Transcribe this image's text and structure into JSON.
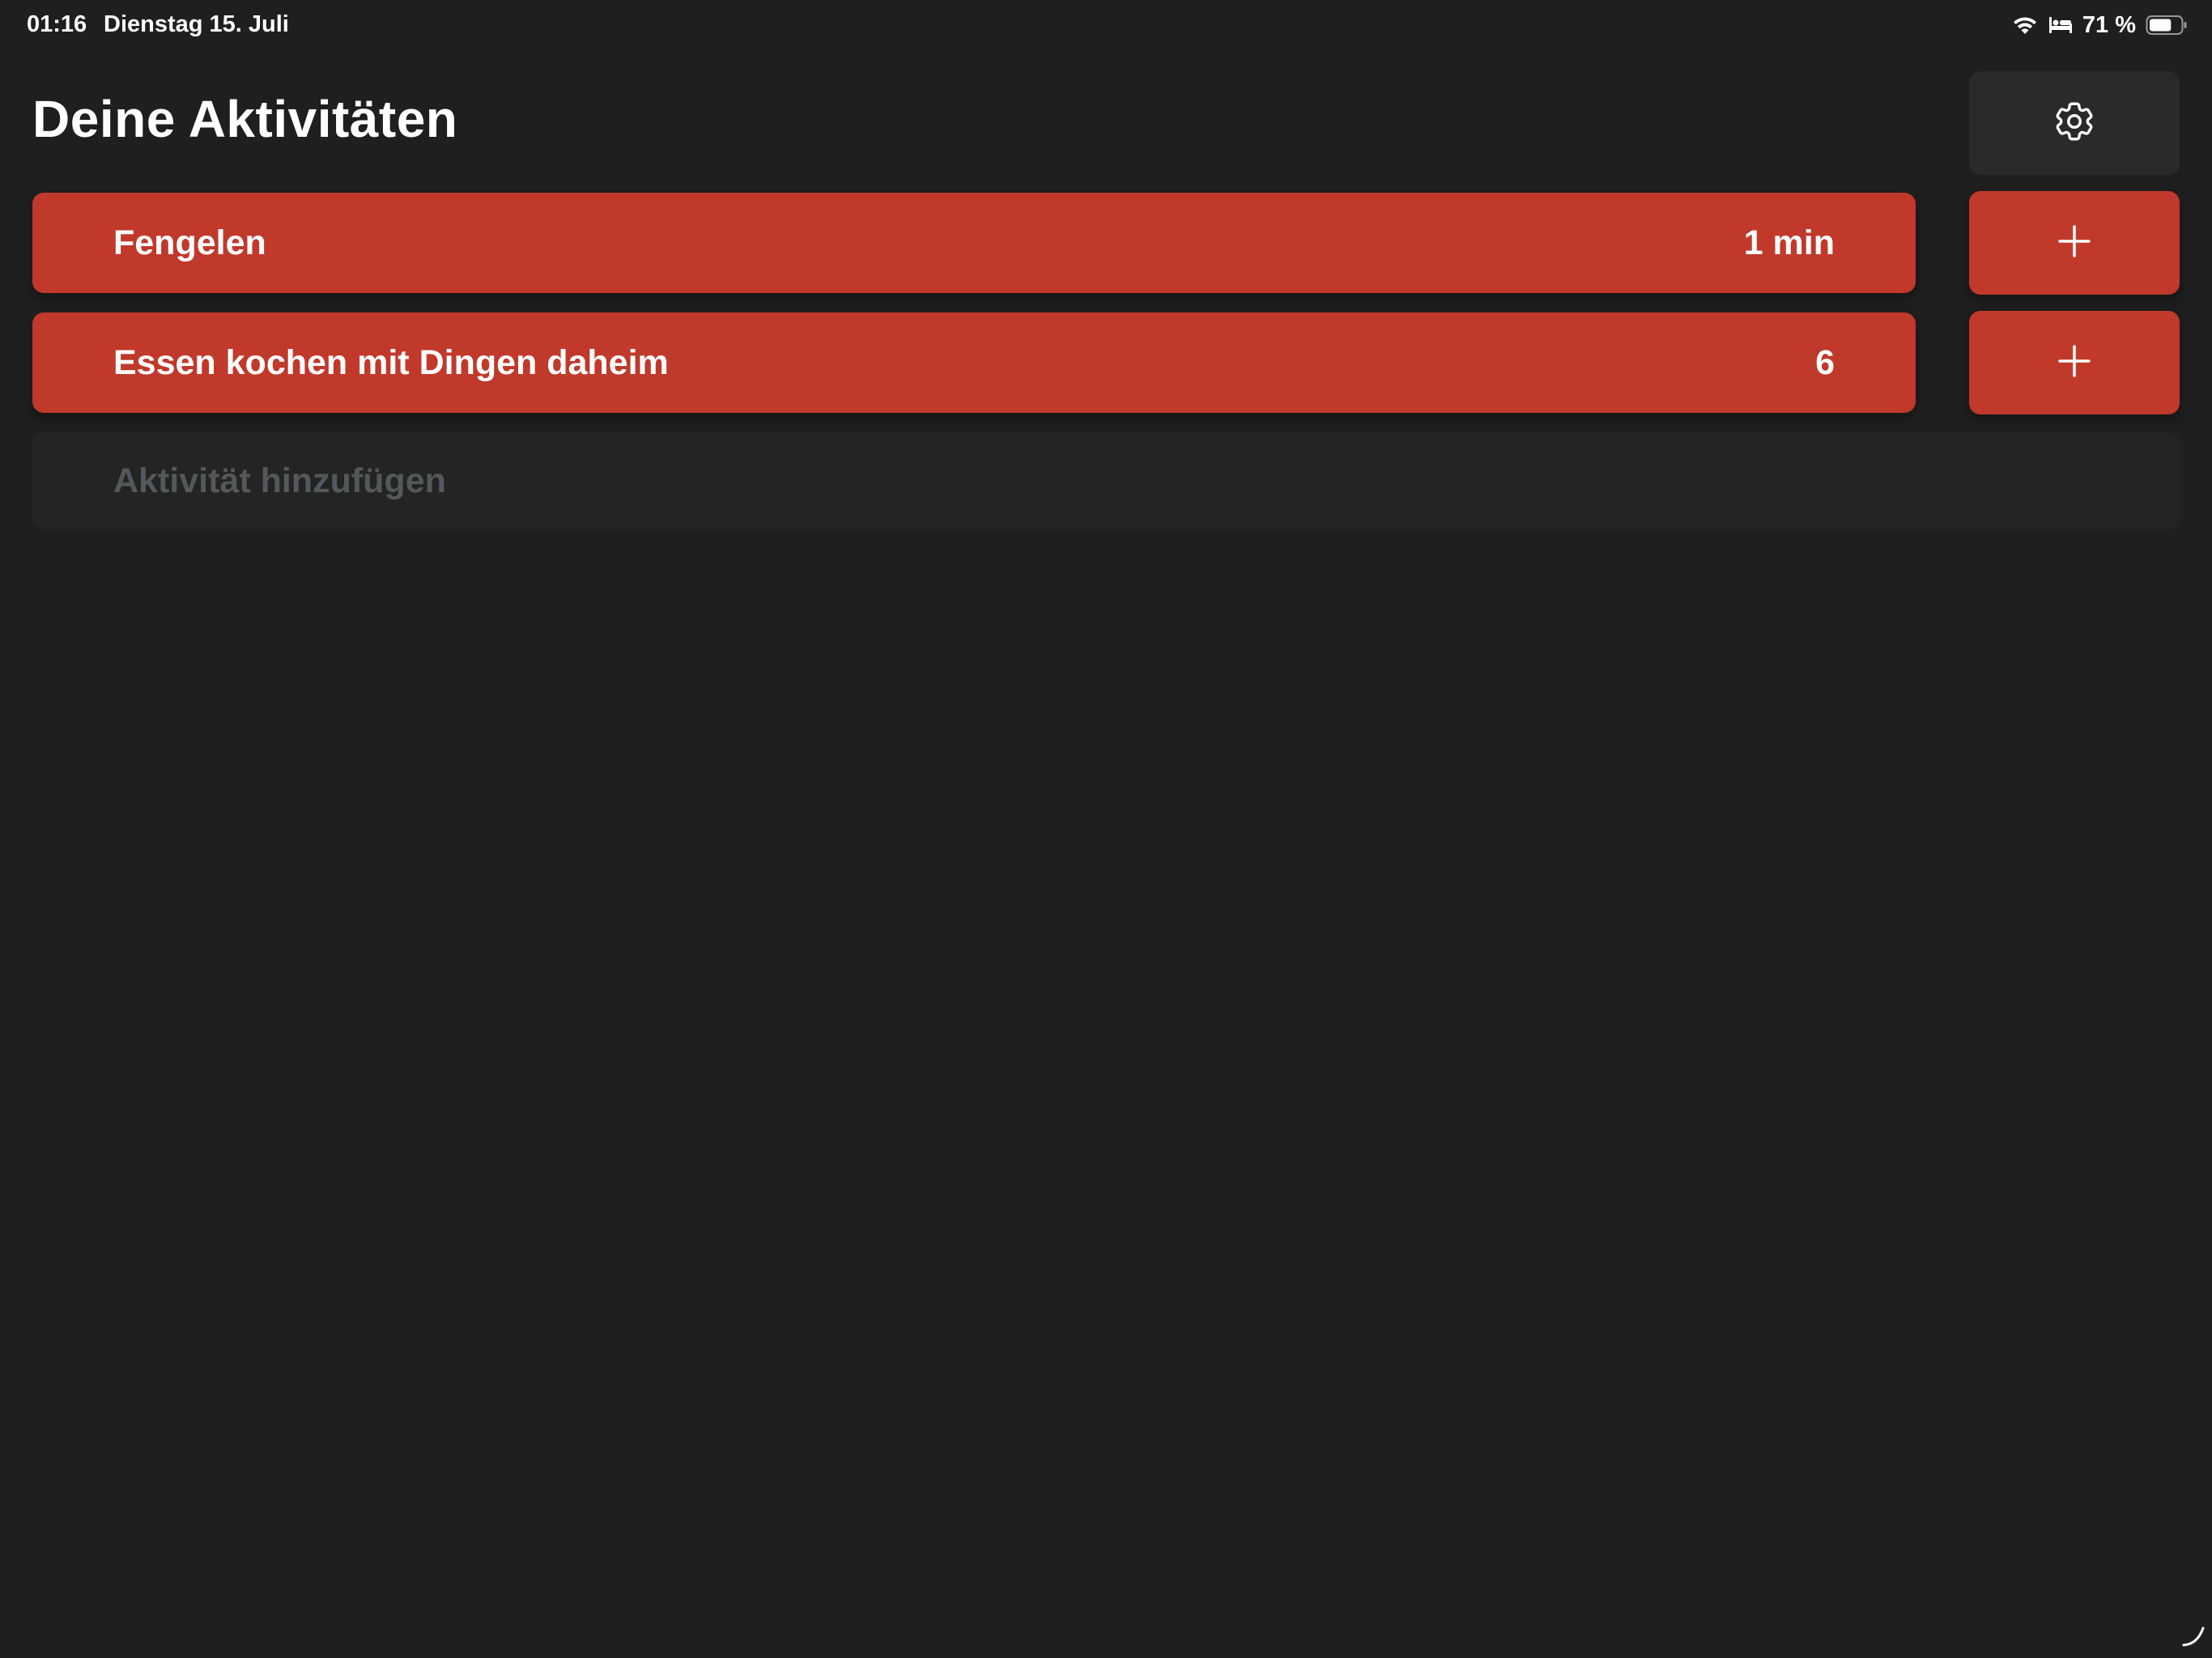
{
  "status_bar": {
    "time": "01:16",
    "date": "Dienstag 15. Juli",
    "battery_percent": "71 %",
    "battery_level": 0.71,
    "icons": [
      "wifi-icon",
      "sleep-bed-icon",
      "battery-icon"
    ]
  },
  "header": {
    "title": "Deine Aktivitäten",
    "settings_icon": "gear-icon"
  },
  "activities": [
    {
      "name": "Fengelen",
      "value": "1 min",
      "add_icon": "plus-icon"
    },
    {
      "name": "Essen kochen mit Dingen daheim",
      "value": "6",
      "add_icon": "plus-icon"
    }
  ],
  "add_activity": {
    "placeholder": "Aktivität hinzufügen",
    "value": ""
  },
  "colors": {
    "background": "#1f1f1f",
    "accent": "#c0392b",
    "settings_button": "#2a2a2c",
    "input_background": "#232424",
    "placeholder_text": "#55585a"
  }
}
